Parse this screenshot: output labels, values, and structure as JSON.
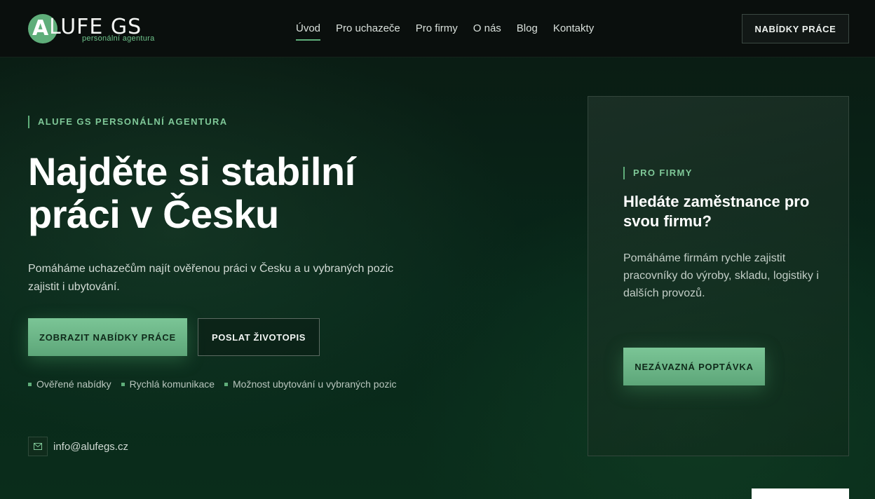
{
  "brand": {
    "logo_letter": "A",
    "logo_name": "LUFE GS",
    "logo_tagline": "personální agentura"
  },
  "nav": {
    "items": [
      {
        "label": "Úvod",
        "active": true
      },
      {
        "label": "Pro uchazeče",
        "active": false
      },
      {
        "label": "Pro firmy",
        "active": false
      },
      {
        "label": "O nás",
        "active": false
      },
      {
        "label": "Blog",
        "active": false
      },
      {
        "label": "Kontakty",
        "active": false
      }
    ],
    "cta_label": "NABÍDKY PRÁCE"
  },
  "hero": {
    "eyebrow": "ALUFE GS PERSONÁLNÍ AGENTURA",
    "title_line1": "Najděte si stabilní",
    "title_line2": "práci v Česku",
    "description": "Pomáháme uchazečům najít ověřenou práci v Česku a u vybraných pozic zajistit i ubytování.",
    "primary_button": "ZOBRAZIT NABÍDKY PRÁCE",
    "secondary_button": "POSLAT ŽIVOTOPIS",
    "features": [
      "Ověřené nabídky",
      "Rychlá komunikace",
      "Možnost ubytování u vybraných pozic"
    ],
    "email": "info@alufegs.cz"
  },
  "company_card": {
    "eyebrow": "PRO FIRMY",
    "title": "Hledáte zaměstnance pro svou firmu?",
    "description": "Pomáháme firmám rychle zajistit pracovníky do výroby, skladu, logistiky i dalších provozů.",
    "button": "NEZÁVAZNÁ POPTÁVKA"
  },
  "icons": {
    "mail": "mail-icon"
  },
  "colors": {
    "accent": "#5fae7a",
    "background": "#071a10",
    "header": "#0a0f0d"
  }
}
